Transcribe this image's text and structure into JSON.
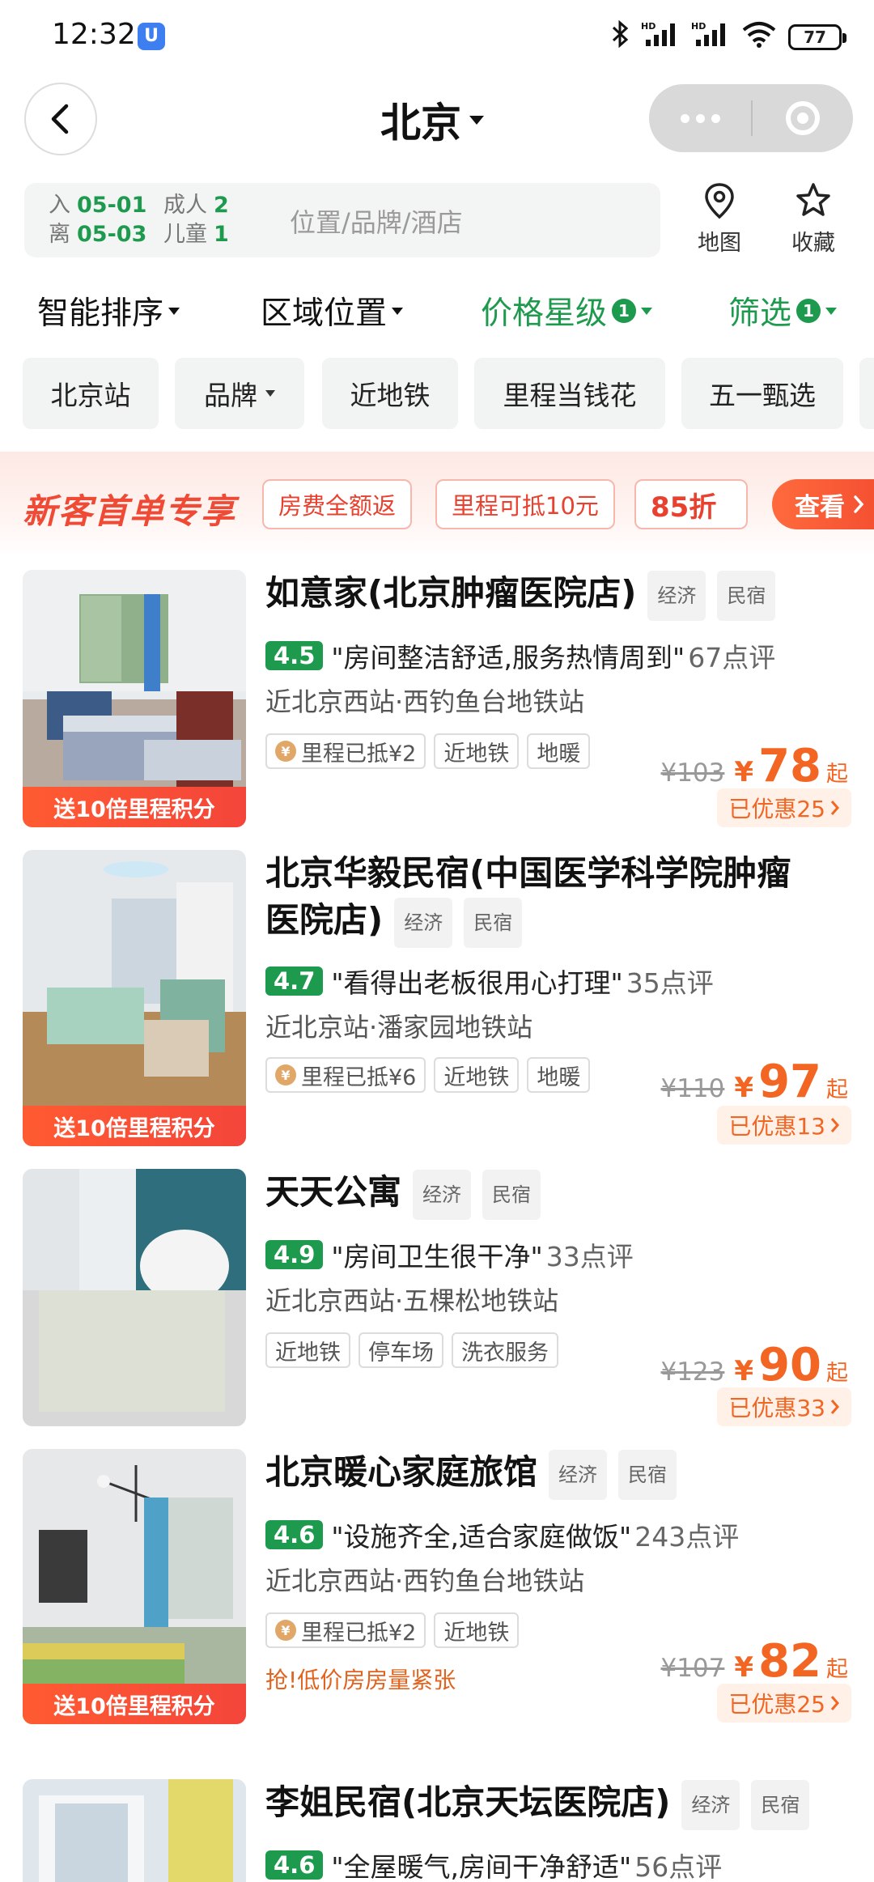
{
  "status_bar": {
    "time": "12:32",
    "app_icon": "U",
    "signal_label_1": "HD",
    "signal_label_2": "HD",
    "battery": "77"
  },
  "header": {
    "city": "北京"
  },
  "search": {
    "checkin_label": "入",
    "checkin_date": "05-01",
    "checkout_label": "离",
    "checkout_date": "05-03",
    "adults_label": "成人",
    "adults": "2",
    "children_label": "儿童",
    "children": "1",
    "placeholder": "位置/品牌/酒店"
  },
  "tools": {
    "map": "地图",
    "favorites": "收藏"
  },
  "sort_bar": {
    "smart": "智能排序",
    "area": "区域位置",
    "price": "价格星级",
    "price_badge": "1",
    "filter": "筛选",
    "filter_badge": "1"
  },
  "quick_tags": [
    "北京站",
    "品牌",
    "近地铁",
    "里程当钱花",
    "五一甄选"
  ],
  "promo": {
    "title": "新客首单专享",
    "chips": [
      "房费全额返",
      "里程可抵10元",
      "85折"
    ],
    "button": "查看"
  },
  "listings": [
    {
      "name": "如意家(北京肿瘤医院店)",
      "types": [
        "经济",
        "民宿"
      ],
      "score": "4.5",
      "quote": "\"房间整洁舒适,服务热情周到\"",
      "reviews": "67点评",
      "location": "近北京西站·西钓鱼台地铁站",
      "mileage": "里程已抵¥2",
      "tags": [
        "近地铁",
        "地暖"
      ],
      "orig_price": "¥103",
      "currency": "¥",
      "price": "78",
      "qi": "起",
      "saved": "已优惠25",
      "ribbon": "送10倍里程积分"
    },
    {
      "name_line1": "北京华毅民宿(中国医学科学院肿瘤",
      "name_line2": "医院店)",
      "types": [
        "经济",
        "民宿"
      ],
      "score": "4.7",
      "quote": "\"看得出老板很用心打理\"",
      "reviews": "35点评",
      "location": "近北京站·潘家园地铁站",
      "mileage": "里程已抵¥6",
      "tags": [
        "近地铁",
        "地暖"
      ],
      "orig_price": "¥110",
      "currency": "¥",
      "price": "97",
      "qi": "起",
      "saved": "已优惠13",
      "ribbon": "送10倍里程积分"
    },
    {
      "name": "天天公寓",
      "types": [
        "经济",
        "民宿"
      ],
      "score": "4.9",
      "quote": "\"房间卫生很干净\"",
      "reviews": "33点评",
      "location": "近北京西站·五棵松地铁站",
      "tags": [
        "近地铁",
        "停车场",
        "洗衣服务"
      ],
      "orig_price": "¥123",
      "currency": "¥",
      "price": "90",
      "qi": "起",
      "saved": "已优惠33"
    },
    {
      "name": "北京暖心家庭旅馆",
      "types": [
        "经济",
        "民宿"
      ],
      "score": "4.6",
      "quote": "\"设施齐全,适合家庭做饭\"",
      "reviews": "243点评",
      "location": "近北京西站·西钓鱼台地铁站",
      "mileage": "里程已抵¥2",
      "tags": [
        "近地铁"
      ],
      "urgent": "抢!低价房房量紧张",
      "orig_price": "¥107",
      "currency": "¥",
      "price": "82",
      "qi": "起",
      "saved": "已优惠25",
      "ribbon": "送10倍里程积分"
    },
    {
      "name": "李姐民宿(北京天坛医院店)",
      "types": [
        "经济",
        "民宿"
      ],
      "score": "4.6",
      "quote": "\"全屋暖气,房间干净舒适\"",
      "reviews": "56点评"
    }
  ],
  "colors": {
    "brand_green": "#1e9a4e",
    "price_orange": "#f26522",
    "promo_red": "#ee4a36"
  }
}
